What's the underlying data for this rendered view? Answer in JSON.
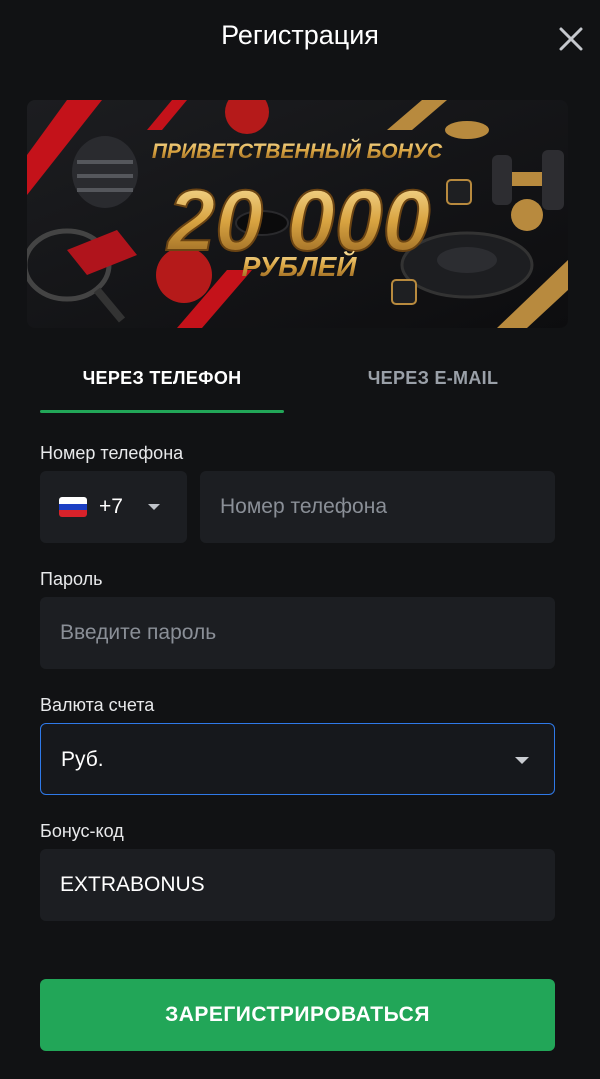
{
  "header": {
    "title": "Регистрация",
    "close_icon": "close-icon"
  },
  "banner": {
    "line1": "ПРИВЕТСТВЕННЫЙ БОНУС",
    "amount": "20 000",
    "line3": "РУБЛЕЙ"
  },
  "tabs": [
    {
      "label": "ЧЕРЕЗ ТЕЛЕФОН",
      "active": true
    },
    {
      "label": "ЧЕРЕЗ E-MAIL",
      "active": false
    }
  ],
  "form": {
    "phone": {
      "label": "Номер телефона",
      "country_code": "+7",
      "country_flag": "russia-flag-icon",
      "placeholder": "Номер телефона"
    },
    "password": {
      "label": "Пароль",
      "placeholder": "Введите пароль"
    },
    "currency": {
      "label": "Валюта счета",
      "value": "Руб."
    },
    "bonus": {
      "label": "Бонус-код",
      "value": "EXTRABONUS"
    },
    "submit_label": "ЗАРЕГИСТРИРОВАТЬСЯ"
  },
  "colors": {
    "background": "#111214",
    "field": "#1c1e22",
    "accent_green": "#22a658",
    "focus_blue": "#2f79e8",
    "gold": "#d9a441"
  }
}
